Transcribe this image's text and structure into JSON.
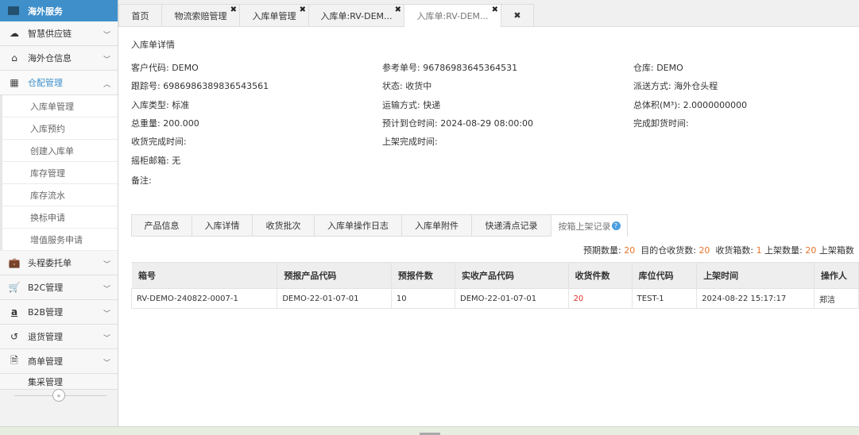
{
  "sidebar": {
    "brand": "海外服务",
    "items": [
      {
        "label": "智慧供应链",
        "icon": "cloud-icon"
      },
      {
        "label": "海外仓信息",
        "icon": "home-icon"
      },
      {
        "label": "仓配管理",
        "icon": "grid-icon"
      },
      {
        "label": "头程委托单",
        "icon": "briefcase-icon"
      },
      {
        "label": "B2C管理",
        "icon": "cart-icon"
      },
      {
        "label": "B2B管理",
        "icon": "amazon-icon"
      },
      {
        "label": "退货管理",
        "icon": "undo-icon"
      },
      {
        "label": "商单管理",
        "icon": "document-icon"
      },
      {
        "label": "集采管理",
        "icon": "box-icon"
      }
    ],
    "sub_items": [
      "入库单管理",
      "入库预约",
      "创建入库单",
      "库存管理",
      "库存流水",
      "换标申请",
      "增值服务申请"
    ]
  },
  "tabs": [
    {
      "label": "首页"
    },
    {
      "label": "物流索赔管理"
    },
    {
      "label": "入库单管理"
    },
    {
      "label": "入库单:RV-DEM..."
    },
    {
      "label": "入库单:RV-DEM..."
    }
  ],
  "close_all": "✖",
  "detail": {
    "title": "入库单详情",
    "customer_code": "客户代码:  DEMO",
    "tracking_no": "跟踪号:  6986986389836543561",
    "inbound_type": "入库类型:  标准",
    "total_weight": "总重量:  200.000",
    "receive_done_time": "收货完成时间:",
    "suitcase": "摇柜邮箱:  无",
    "remarks": "备注:",
    "ref_no": "参考单号:  96786983645364531",
    "status": "状态:  收货中",
    "transport": "运输方式:  快递",
    "eta": "预计到仓时间:  2024-08-29 08:00:00",
    "shelf_done_time": "上架完成时间:",
    "warehouse": "仓库:  DEMO",
    "delivery_method": "派送方式:  海外仓头程",
    "total_volume": "总体积(M³):  2.0000000000",
    "unload_done_time": "完成卸货时间:"
  },
  "subtabs": [
    "产品信息",
    "入库详情",
    "收货批次",
    "入库单操作日志",
    "入库单附件",
    "快递清点记录",
    "按箱上架记录"
  ],
  "summary": {
    "expected_label": "预期数量:",
    "expected_value": "20",
    "received_label": "目的仓收货数:",
    "received_value": "20",
    "boxes_label": "收货箱数:",
    "boxes_value": "1",
    "shelved_label": "上架数量:",
    "shelved_value": "20",
    "shelved_boxes_label": "上架箱数"
  },
  "table": {
    "headers": [
      "箱号",
      "预报产品代码",
      "预报件数",
      "实收产品代码",
      "收货件数",
      "库位代码",
      "上架时间",
      "操作人"
    ],
    "rows": [
      [
        "RV-DEMO-240822-0007-1",
        "DEMO-22-01-07-01",
        "10",
        "DEMO-22-01-07-01",
        "20",
        "TEST-1",
        "2024-08-22 15:17:17",
        "郑洁"
      ]
    ]
  },
  "colors": {
    "accent": "#3e8fca",
    "highlight": "#e8732c",
    "alert": "#e0302a"
  }
}
